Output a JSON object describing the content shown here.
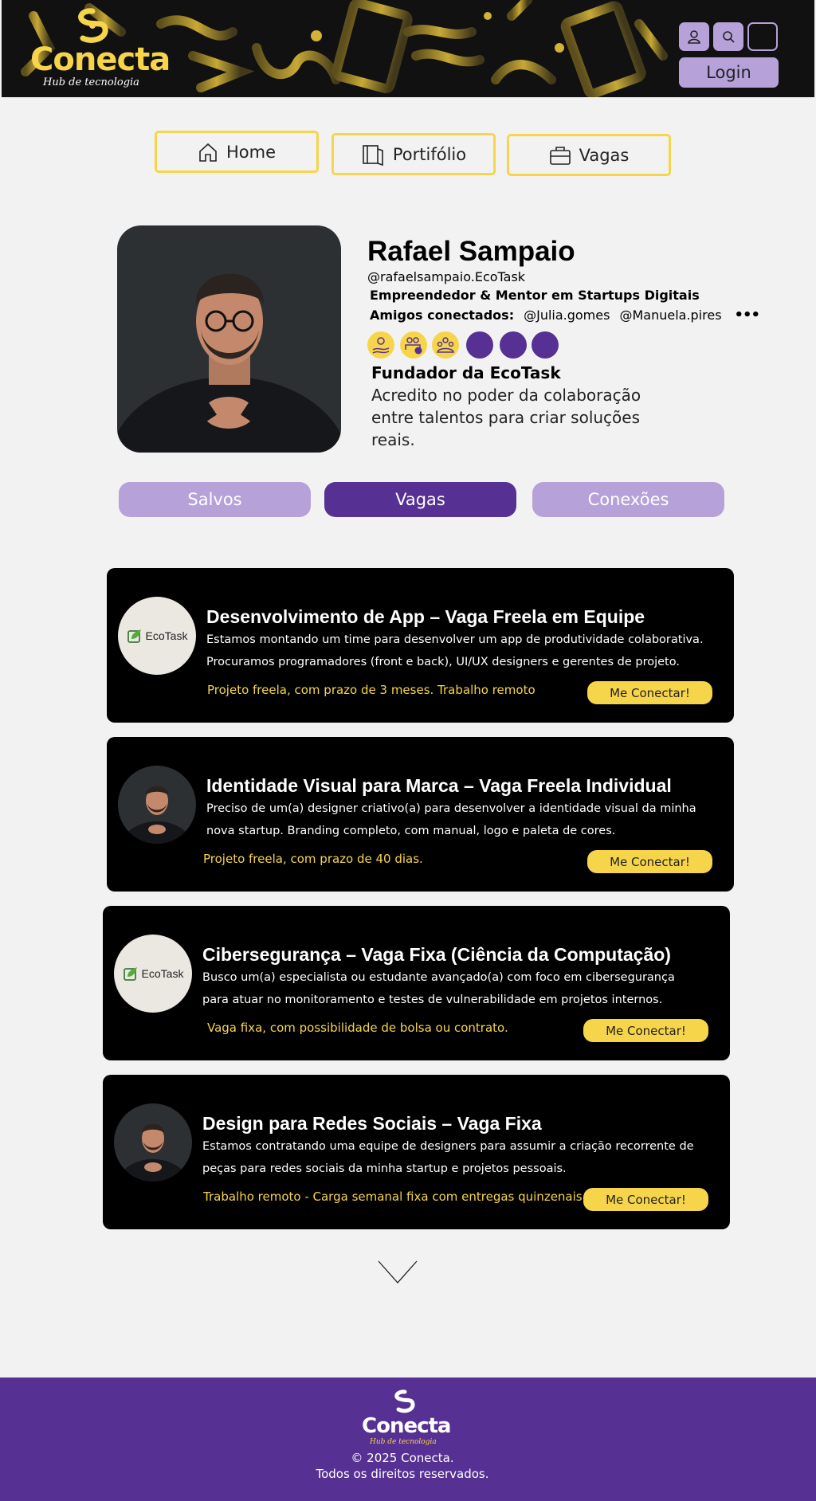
{
  "header": {
    "brand": "Conecta",
    "tagline": "Hub de tecnologia",
    "icons": [
      "user-icon",
      "search-icon",
      "blank"
    ],
    "login_label": "Login"
  },
  "nav": [
    {
      "label": "Home",
      "icon": "home-icon"
    },
    {
      "label": "Portifólio",
      "icon": "book-icon"
    },
    {
      "label": "Vagas",
      "icon": "briefcase-icon"
    }
  ],
  "profile": {
    "name": "Rafael Sampaio",
    "handle": "@rafaelsampaio.EcoTask",
    "role": "Empreendedor & Mentor em Startups Digitais",
    "friends_label": "Amigos conectados:",
    "friends": [
      "@Julia.gomes",
      "@Manuela.pires"
    ],
    "more": "•••",
    "founder": "Fundador da EcoTask",
    "bio": "Acredito no poder da colaboração entre talentos para criar soluções reais.",
    "badges": [
      "hand-coin-icon",
      "money-people-icon",
      "team-icon",
      "purple",
      "purple",
      "purple"
    ]
  },
  "tabs": [
    {
      "label": "Salvos",
      "active": false
    },
    {
      "label": "Vagas",
      "active": true
    },
    {
      "label": "Conexões",
      "active": false
    }
  ],
  "cards": [
    {
      "avatar": "ecotask",
      "logo_text": "EcoTask",
      "title": "Desenvolvimento de App – Vaga Freela em Equipe",
      "desc": "Estamos montando um time para desenvolver um app de produtividade colaborativa. Procuramos programadores (front e back), UI/UX designers e gerentes de projeto.",
      "note": "Projeto freela, com prazo de 3 meses. Trabalho remoto",
      "button": "Me Conectar!"
    },
    {
      "avatar": "person",
      "logo_text": "",
      "title": "Identidade Visual para Marca – Vaga Freela Individual",
      "desc": "Preciso de um(a) designer criativo(a) para desenvolver a identidade visual da minha nova startup. Branding completo, com manual, logo e paleta de cores.",
      "note": "Projeto freela, com prazo de 40 dias.",
      "button": "Me Conectar!"
    },
    {
      "avatar": "ecotask",
      "logo_text": "EcoTask",
      "title": "Cibersegurança – Vaga Fixa (Ciência da Computação)",
      "desc": "Busco um(a) especialista ou estudante avançado(a) com foco em cibersegurança para atuar no monitoramento e testes de vulnerabilidade em projetos internos.",
      "note": "Vaga fixa, com possibilidade de bolsa ou contrato.",
      "button": "Me Conectar!"
    },
    {
      "avatar": "person",
      "logo_text": "",
      "title": "Design para Redes Sociais – Vaga Fixa",
      "desc": "Estamos  contratando uma equipe de designers para assumir a criação recorrente de peças para redes sociais da minha startup e projetos pessoais.",
      "note": "Trabalho remoto -  Carga semanal fixa com entregas quinzenais.",
      "button": "Me Conectar!"
    }
  ],
  "footer": {
    "brand": "Conecta",
    "tagline": "Hub de tecnologia",
    "copyright": "© 2025 Conecta.",
    "rights": "Todos os direitos reservados."
  },
  "colors": {
    "yellow": "#f7d54a",
    "purple": "#563092",
    "lavender": "#b6a1d9",
    "background": "#f2f2f2"
  }
}
